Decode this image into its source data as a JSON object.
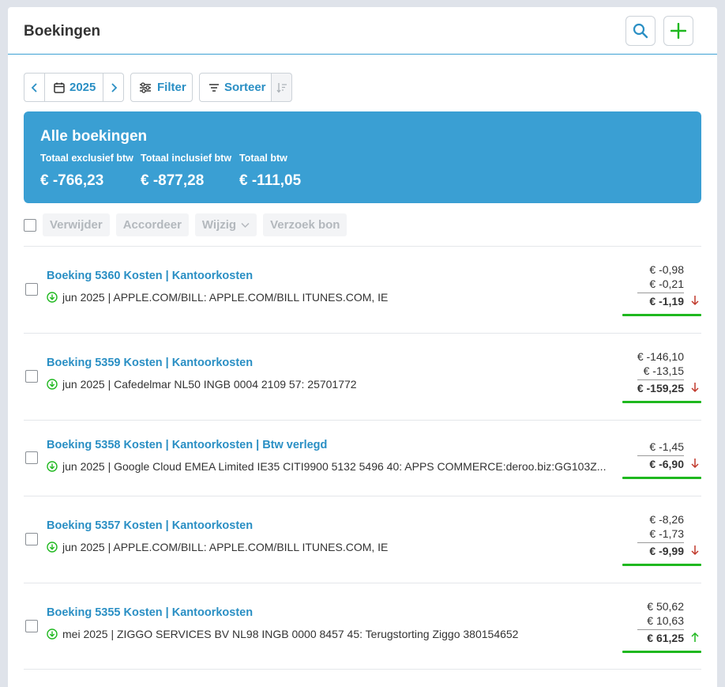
{
  "header": {
    "title": "Boekingen",
    "search_icon": "search-icon",
    "add_icon": "plus-icon"
  },
  "toolbar": {
    "year": "2025",
    "filter_label": "Filter",
    "sort_label": "Sorteer"
  },
  "summary": {
    "title": "Alle boekingen",
    "excl_label": "Totaal exclusief btw",
    "excl_value": "€ -766,23",
    "incl_label": "Totaal inclusief btw",
    "incl_value": "€ -877,28",
    "btw_label": "Totaal btw",
    "btw_value": "€ -111,05"
  },
  "actions": {
    "delete": "Verwijder",
    "approve": "Accordeer",
    "edit": "Wijzig",
    "request_receipt": "Verzoek bon"
  },
  "colors": {
    "accent": "#3a9fd3",
    "link": "#2a8fc4",
    "green": "#1fb81f",
    "red": "#c0392b"
  },
  "bookings": [
    {
      "title": "Boeking 5360 Kosten | Kantoorkosten",
      "desc": "jun 2025 | APPLE.COM/BILL: APPLE.COM/BILL ITUNES.COM, IE",
      "amount1": "€ -0,98",
      "amount2": "€ -0,21",
      "total": "€ -1,19",
      "direction": "down"
    },
    {
      "title": "Boeking 5359 Kosten | Kantoorkosten",
      "desc": "jun 2025 | Cafedelmar NL50 INGB 0004 2109 57: 25701772",
      "amount1": "€ -146,10",
      "amount2": "€ -13,15",
      "total": "€ -159,25",
      "direction": "down"
    },
    {
      "title": "Boeking 5358 Kosten | Kantoorkosten | Btw verlegd",
      "desc": "jun 2025 | Google Cloud EMEA Limited IE35 CITI9900 5132 5496 40: APPS COMMERCE:deroo.biz:GG103Z...",
      "amount1": "€ -1,45",
      "total": "€ -6,90",
      "direction": "down"
    },
    {
      "title": "Boeking 5357 Kosten | Kantoorkosten",
      "desc": "jun 2025 | APPLE.COM/BILL: APPLE.COM/BILL ITUNES.COM, IE",
      "amount1": "€ -8,26",
      "amount2": "€ -1,73",
      "total": "€ -9,99",
      "direction": "down"
    },
    {
      "title": "Boeking 5355 Kosten | Kantoorkosten",
      "desc": "mei 2025 | ZIGGO SERVICES BV NL98 INGB 0000 8457 45: Terugstorting Ziggo 380154652",
      "amount1": "€ 50,62",
      "amount2": "€ 10,63",
      "total": "€ 61,25",
      "direction": "up"
    }
  ]
}
